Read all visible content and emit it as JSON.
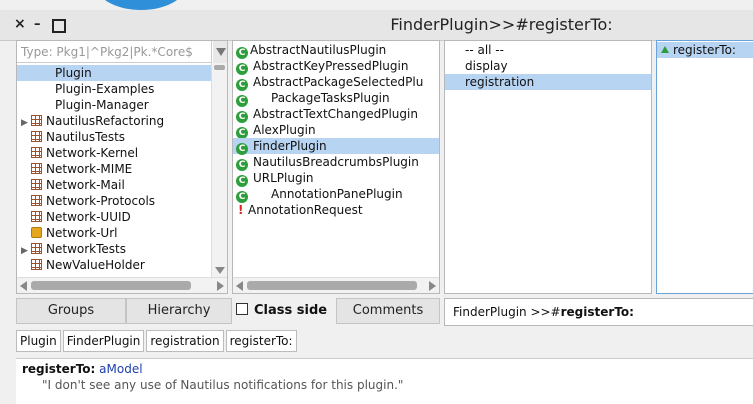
{
  "window": {
    "title": "FinderPlugin>>#registerTo:",
    "controls": [
      "×",
      "–",
      "□"
    ]
  },
  "packages": {
    "search_placeholder": "Type: Pkg1|^Pkg2|Pk.*Core$",
    "items": [
      {
        "label": "Plugin",
        "icon": "none",
        "expandable": false,
        "selected": true
      },
      {
        "label": "Plugin-Examples",
        "icon": "none",
        "expandable": false,
        "selected": false
      },
      {
        "label": "Plugin-Manager",
        "icon": "none",
        "expandable": false,
        "selected": false
      },
      {
        "label": "NautilusRefactoring",
        "icon": "package-icon",
        "expandable": true,
        "selected": false
      },
      {
        "label": "NautilusTests",
        "icon": "package-icon",
        "expandable": false,
        "selected": false
      },
      {
        "label": "Network-Kernel",
        "icon": "package-icon",
        "expandable": false,
        "selected": false
      },
      {
        "label": "Network-MIME",
        "icon": "package-icon",
        "expandable": false,
        "selected": false
      },
      {
        "label": "Network-Mail",
        "icon": "package-icon",
        "expandable": false,
        "selected": false
      },
      {
        "label": "Network-Protocols",
        "icon": "package-icon",
        "expandable": false,
        "selected": false
      },
      {
        "label": "Network-UUID",
        "icon": "package-icon",
        "expandable": false,
        "selected": false
      },
      {
        "label": "Network-Url",
        "icon": "package-gold-icon",
        "expandable": false,
        "selected": false
      },
      {
        "label": "NetworkTests",
        "icon": "package-icon",
        "expandable": true,
        "selected": false
      },
      {
        "label": "NewValueHolder",
        "icon": "package-icon",
        "expandable": false,
        "selected": false
      }
    ]
  },
  "classes": {
    "items": [
      {
        "label": "AbstractNautilusPlugin",
        "icon": "class-icon",
        "indent": 0,
        "selected": false
      },
      {
        "label": "AbstractKeyPressedPlugin",
        "icon": "class-icon",
        "indent": 1,
        "selected": false
      },
      {
        "label": "AbstractPackageSelectedPlu",
        "icon": "class-icon",
        "indent": 1,
        "selected": false
      },
      {
        "label": "PackageTasksPlugin",
        "icon": "class-icon",
        "indent": 2,
        "selected": false
      },
      {
        "label": "AbstractTextChangedPlugin",
        "icon": "class-icon",
        "indent": 1,
        "selected": false
      },
      {
        "label": "AlexPlugin",
        "icon": "class-icon",
        "indent": 1,
        "selected": false
      },
      {
        "label": "FinderPlugin",
        "icon": "class-icon",
        "indent": 1,
        "selected": true
      },
      {
        "label": "NautilusBreadcrumbsPlugin",
        "icon": "class-icon",
        "indent": 1,
        "selected": false
      },
      {
        "label": "URLPlugin",
        "icon": "class-icon",
        "indent": 1,
        "selected": false
      },
      {
        "label": "AnnotationPanePlugin",
        "icon": "class-icon",
        "indent": 2,
        "selected": false
      },
      {
        "label": "AnnotationRequest",
        "icon": "error-icon",
        "indent": 0,
        "selected": false
      }
    ]
  },
  "protocols": {
    "items": [
      {
        "label": "-- all --",
        "selected": false
      },
      {
        "label": "display",
        "selected": false
      },
      {
        "label": "registration",
        "selected": true
      }
    ]
  },
  "methods": {
    "items": [
      {
        "label": "registerTo:",
        "selected": true
      }
    ]
  },
  "toolbar": {
    "groups_label": "Groups",
    "hierarchy_label": "Hierarchy",
    "class_side_label": "Class side",
    "comments_label": "Comments"
  },
  "definition": {
    "prefix": "FinderPlugin >>#",
    "selector": "registerTo:"
  },
  "breadcrumbs": [
    "Plugin",
    "FinderPlugin",
    "registration",
    "registerTo:"
  ],
  "source": {
    "selector": "registerTo:",
    "argument": "aModel",
    "comment": "\"I don't see any use of Nautilus notifications for this plugin.\""
  },
  "colors": {
    "selection": "#b7d4f2",
    "class_icon": "#2e9e3c",
    "argument": "#1f3fae",
    "brand_arc": "#2f8fd8"
  }
}
